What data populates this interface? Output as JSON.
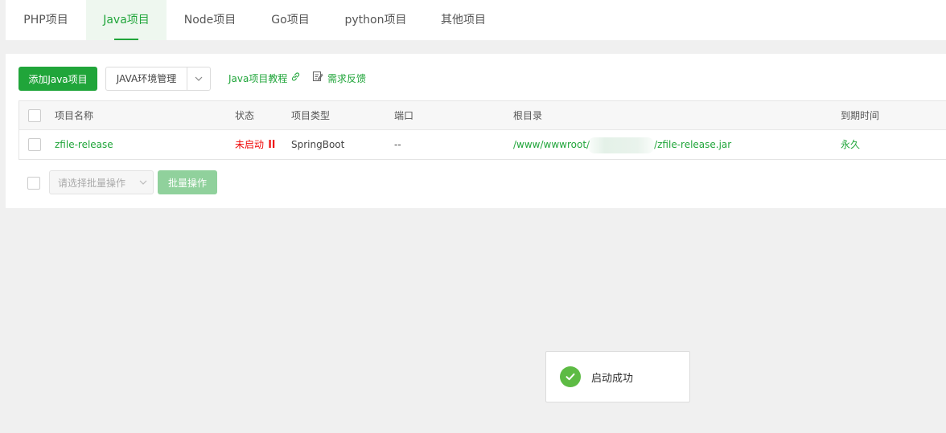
{
  "tabs": [
    {
      "label": "PHP项目",
      "active": false
    },
    {
      "label": "Java项目",
      "active": true
    },
    {
      "label": "Node项目",
      "active": false
    },
    {
      "label": "Go项目",
      "active": false
    },
    {
      "label": "python项目",
      "active": false
    },
    {
      "label": "其他项目",
      "active": false
    }
  ],
  "toolbar": {
    "add_label": "添加Java项目",
    "env_label": "JAVA环境管理",
    "tutorial_label": "Java项目教程",
    "feedback_label": "需求反馈"
  },
  "table": {
    "headers": {
      "name": "项目名称",
      "status": "状态",
      "type": "项目类型",
      "port": "端口",
      "root": "根目录",
      "expire": "到期时间"
    },
    "rows": [
      {
        "name": "zfile-release",
        "status": "未启动",
        "type": "SpringBoot",
        "port": "--",
        "root_prefix": "/www/wwwroot/",
        "root_suffix": "/zfile-release.jar",
        "expire": "永久"
      }
    ]
  },
  "batch": {
    "select_placeholder": "请选择批量操作",
    "button_label": "批量操作"
  },
  "toast": {
    "message": "启动成功"
  },
  "colors": {
    "accent": "#20a53a",
    "status_stopped": "#ef0808",
    "toast_success": "#5dbb44"
  }
}
